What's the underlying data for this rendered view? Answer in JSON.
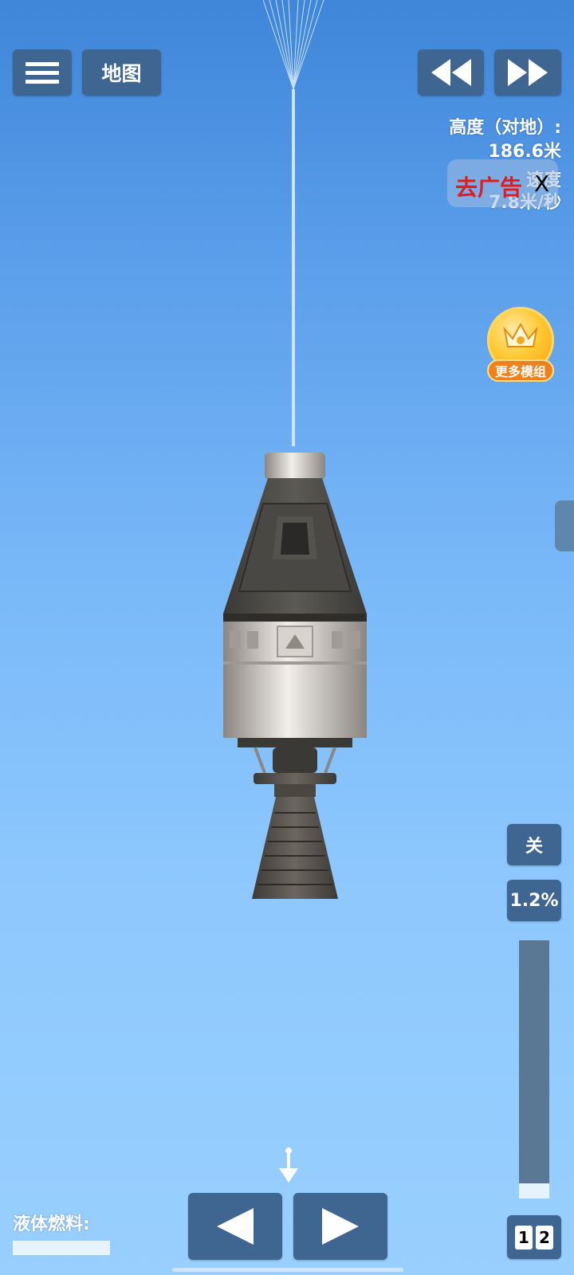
{
  "toolbar": {
    "menu_icon": "hamburger-icon",
    "map_label": "地图",
    "rewind_icon": "rewind-icon",
    "fast_forward_icon": "fast-forward-icon"
  },
  "telemetry": {
    "altitude_label": "高度（对地）:",
    "altitude_value": "186.6米",
    "speed_label": "速度",
    "speed_value": "7.8米/秒"
  },
  "ad": {
    "label": "去广告",
    "close": "X"
  },
  "vip": {
    "icon": "crown-icon",
    "label": "更多模组"
  },
  "throttle": {
    "toggle_label": "关",
    "percent_label": "1.2%",
    "level": 0.06
  },
  "stages": [
    "1",
    "2"
  ],
  "controls": {
    "rotate_left_icon": "triangle-left-icon",
    "rotate_right_icon": "triangle-right-icon",
    "direction_icon": "down-arrow-icon"
  },
  "fuel": {
    "label": "液体燃料:",
    "level": 1.0
  },
  "colors": {
    "button": "#3f6691",
    "sky_top": "#3f86d9",
    "sky_bottom": "#98cffe",
    "ad_text": "#e21b1b",
    "vip_gold": "#ffc933"
  }
}
